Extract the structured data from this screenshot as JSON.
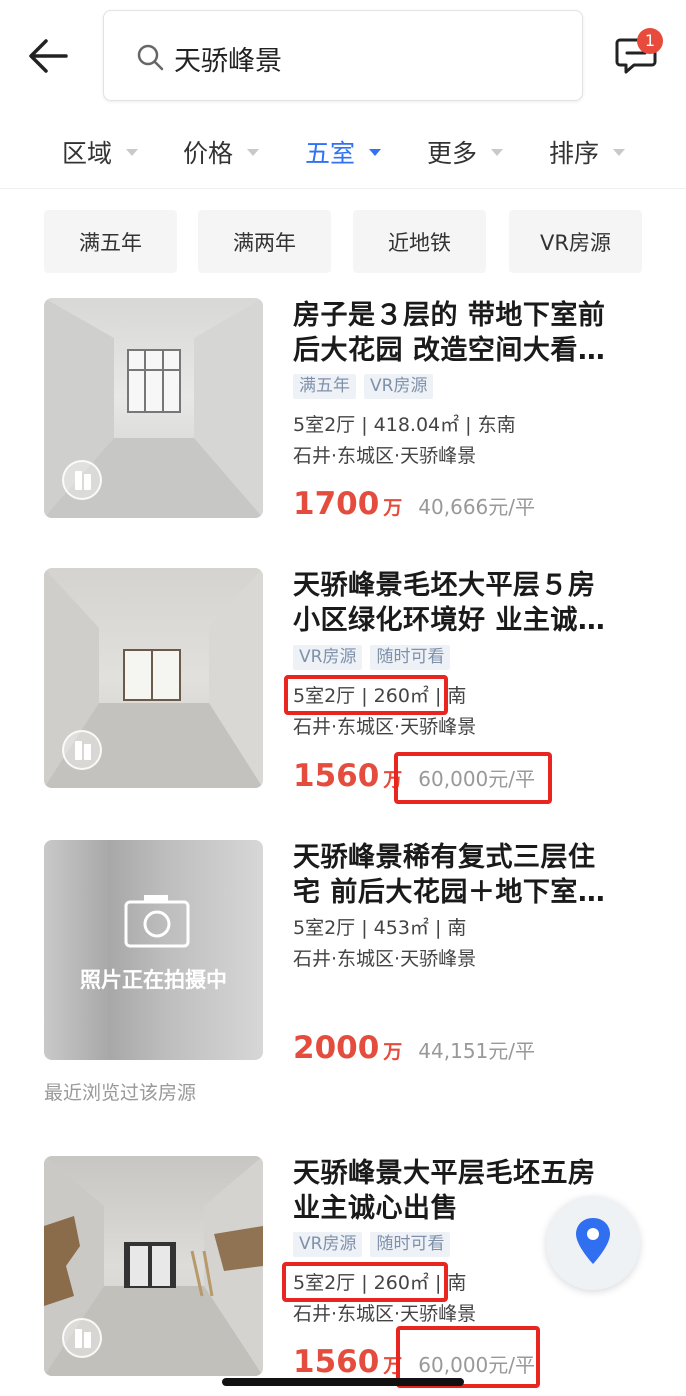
{
  "search": {
    "query": "天骄峰景"
  },
  "header": {
    "message_badge": "1"
  },
  "filters": [
    {
      "label": "区域",
      "active": false
    },
    {
      "label": "价格",
      "active": false
    },
    {
      "label": "五室",
      "active": true
    },
    {
      "label": "更多",
      "active": false
    },
    {
      "label": "排序",
      "active": false
    }
  ],
  "quick_tags": [
    "满五年",
    "满两年",
    "近地铁",
    "VR房源"
  ],
  "listings": [
    {
      "title_line1": "房子是３层的 带地下室前",
      "title_line2": "后大花园 改造空间大看…",
      "tags": [
        "满五年",
        "VR房源"
      ],
      "specs": "5室2厅 | 418.04㎡ | 东南",
      "address": "石井·东城区·天骄峰景",
      "price": "1700",
      "price_unit": "万",
      "unit_price": "40,666元/平",
      "photo_status": ""
    },
    {
      "title_line1": "天骄峰景毛坯大平层５房",
      "title_line2": "小区绿化环境好 业主诚…",
      "tags": [
        "VR房源",
        "随时可看"
      ],
      "specs": "5室2厅 | 260㎡ | 南",
      "address": "石井·东城区·天骄峰景",
      "price": "1560",
      "price_unit": "万",
      "unit_price": "60,000元/平",
      "photo_status": ""
    },
    {
      "title_line1": "天骄峰景稀有复式三层住",
      "title_line2": "宅 前后大花园＋地下室…",
      "tags": [],
      "specs": "5室2厅 | 453㎡ | 南",
      "address": "石井·东城区·天骄峰景",
      "price": "2000",
      "price_unit": "万",
      "unit_price": "44,151元/平",
      "photo_status": "照片正在拍摄中"
    },
    {
      "title_line1": "天骄峰景大平层毛坯五房",
      "title_line2": "业主诚心出售",
      "tags": [
        "VR房源",
        "随时可看"
      ],
      "specs": "5室2厅 | 260㎡ | 南",
      "address": "石井·东城区·天骄峰景",
      "price": "1560",
      "price_unit": "万",
      "unit_price": "60,000元/平",
      "photo_status": ""
    }
  ],
  "recent_note": "最近浏览过该房源",
  "colors": {
    "accent": "#3072f6",
    "price": "#e44d3e",
    "annotation": "#e8251f"
  }
}
